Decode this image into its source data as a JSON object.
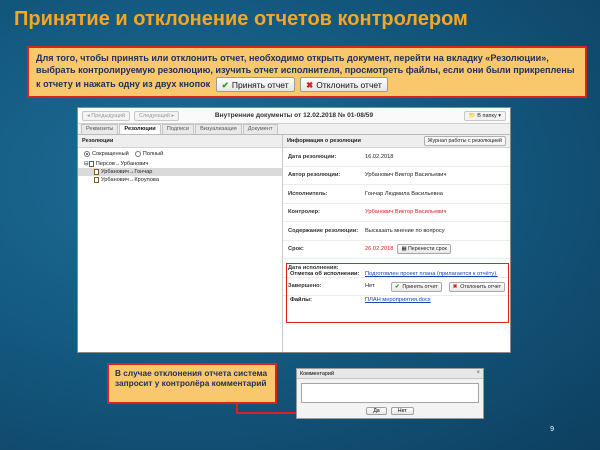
{
  "slide": {
    "title": "Принятие и отклонение отчетов контролером",
    "note_text": "Для того, чтобы принять или отклонить отчет, необходимо открыть документ, перейти на вкладку «Резолюции», выбрать контролируемую резолюцию, изучить отчет исполнителя, просмотреть файлы, если они были прикреплены к отчету и нажать одну из двух кнопок",
    "accept_btn": "Принять отчет",
    "reject_btn": "Отклонить отчет",
    "note2_text": "В случае отклонения отчета система запросит у контролёра комментарий",
    "page_number": "9"
  },
  "app": {
    "prev": "Предыдущий",
    "next": "Следующий",
    "doc_title": "Внутренние документы от 12.02.2018 № 01-08/59",
    "folder": "В папку",
    "tabs": [
      "Реквизиты",
      "Резолюции",
      "Подписи",
      "Визуализация",
      "Документ"
    ],
    "left_header": "Резолюции",
    "radio_short": "Сокращенный",
    "radio_full": "Полный",
    "tree": [
      "Персов→Урбанович",
      "Урбанович→Гончар",
      "Урбанович→Кроулова"
    ],
    "right_header": "Информация о резолюции",
    "journal_btn": "Журнал работы с резолюцией",
    "fields": [
      {
        "label": "Дата резолюции:",
        "value": "16.02.2018"
      },
      {
        "label": "Автор резолюции:",
        "value": "Урбанович Виктор Васильевич"
      },
      {
        "label": "Исполнитель:",
        "value": "Гончар Людмила Васильевна"
      },
      {
        "label": "Контролер:",
        "value": "Урбанович Виктор Васильевич"
      },
      {
        "label": "Содержание резолюции:",
        "value": "Высказать мнение по вопросу"
      },
      {
        "label": "Срок:",
        "value": "26.02.2018"
      },
      {
        "label": "Дата исполнения:",
        "value": ""
      },
      {
        "label": "Завершено:",
        "value": "Нет"
      }
    ],
    "extend_btn": "Перенести срок",
    "report_label": "Отметка об исполнении:",
    "report_value": "Подготовлен проект плана (прилагается к отчёту).",
    "accept_small": "Принять отчет",
    "reject_small": "Отклонить отчет",
    "files_label": "Файлы:",
    "files_value": "ПЛАН мероприятия.docx"
  },
  "dialog": {
    "title": "Комментарий",
    "ok": "Да",
    "cancel": "Нет"
  },
  "colors": {
    "title": "#f5a623",
    "note_bg": "#f9c86c",
    "accent_red": "#d9241b"
  }
}
